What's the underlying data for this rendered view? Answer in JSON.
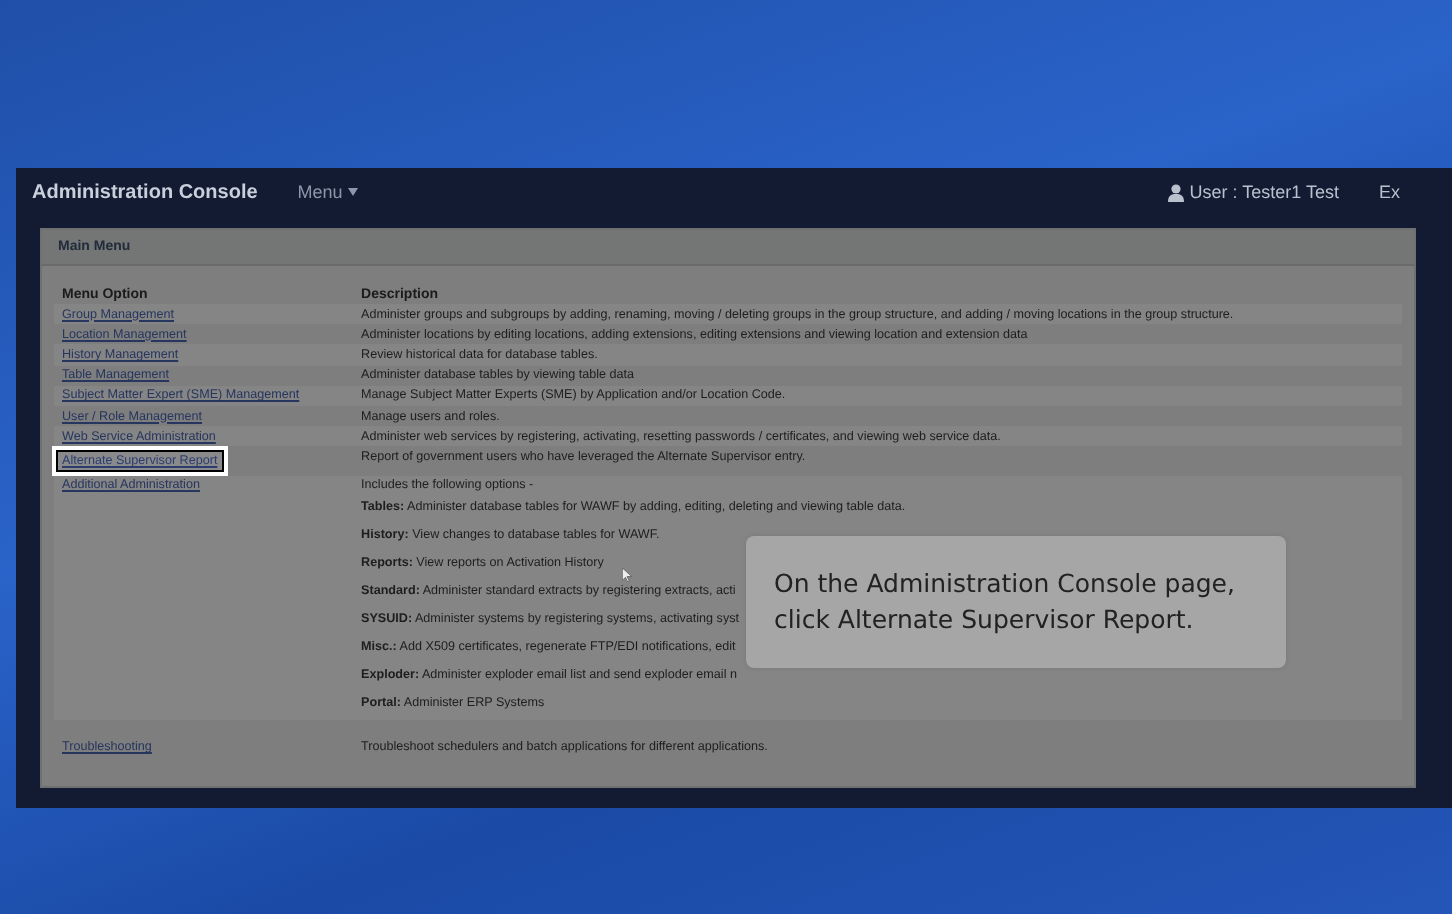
{
  "header": {
    "title": "Administration Console",
    "menu": "Menu",
    "user": "User : Tester1 Test",
    "cut_off_link": "Ex"
  },
  "panel": {
    "title": "Main Menu",
    "columns": [
      "Menu Option",
      "Description"
    ],
    "rows": [
      {
        "option": "Group Management",
        "description": "Administer groups and subgroups by adding, renaming, moving / deleting groups in the group structure, and adding / moving locations in the group structure.",
        "highlighted": false
      },
      {
        "option": "Location Management",
        "description": "Administer locations by editing locations, adding extensions, editing extensions and viewing location and extension data",
        "highlighted": false
      },
      {
        "option": "History Management",
        "description": "Review historical data for database tables.",
        "highlighted": false
      },
      {
        "option": "Table Management",
        "description": "Administer database tables by viewing table data",
        "highlighted": false
      },
      {
        "option": "Subject Matter Expert (SME) Management",
        "description": "Manage Subject Matter Experts (SME) by Application and/or Location Code.",
        "highlighted": false
      },
      {
        "option": "User / Role Management",
        "description": "Manage users and roles.",
        "highlighted": false
      },
      {
        "option": "Web Service Administration",
        "description": "Administer web services by registering, activating, resetting passwords / certificates, and viewing web service data.",
        "highlighted": false
      },
      {
        "option": "Alternate Supervisor Report",
        "description": "Report of government users who have leveraged the Alternate Supervisor entry.",
        "highlighted": true
      },
      {
        "option": "Additional Administration",
        "description": "Includes the following options -",
        "highlighted": false,
        "options": [
          "**Tables:** Administer database tables for WAWF by adding, editing, deleting and viewing table data.",
          "**History:** View changes to database tables for WAWF.",
          "**Reports:** View reports on Activation History",
          "**Standard:** Administer standard extracts by registering extracts, acti",
          "**SYSUID:** Administer systems by registering systems, activating syst",
          "**Misc.:** Add X509 certificates, regenerate FTP/EDI notifications, edit",
          "**Exploder:** Administer exploder email list and send exploder email n",
          "**Portal:** Administer ERP Systems"
        ]
      },
      {
        "option": "Troubleshooting",
        "description": "Troubleshoot schedulers and batch applications for different applications.",
        "highlighted": false
      }
    ]
  },
  "callout": {
    "text": "On the Administration Console page, click Alternate Supervisor Report."
  }
}
